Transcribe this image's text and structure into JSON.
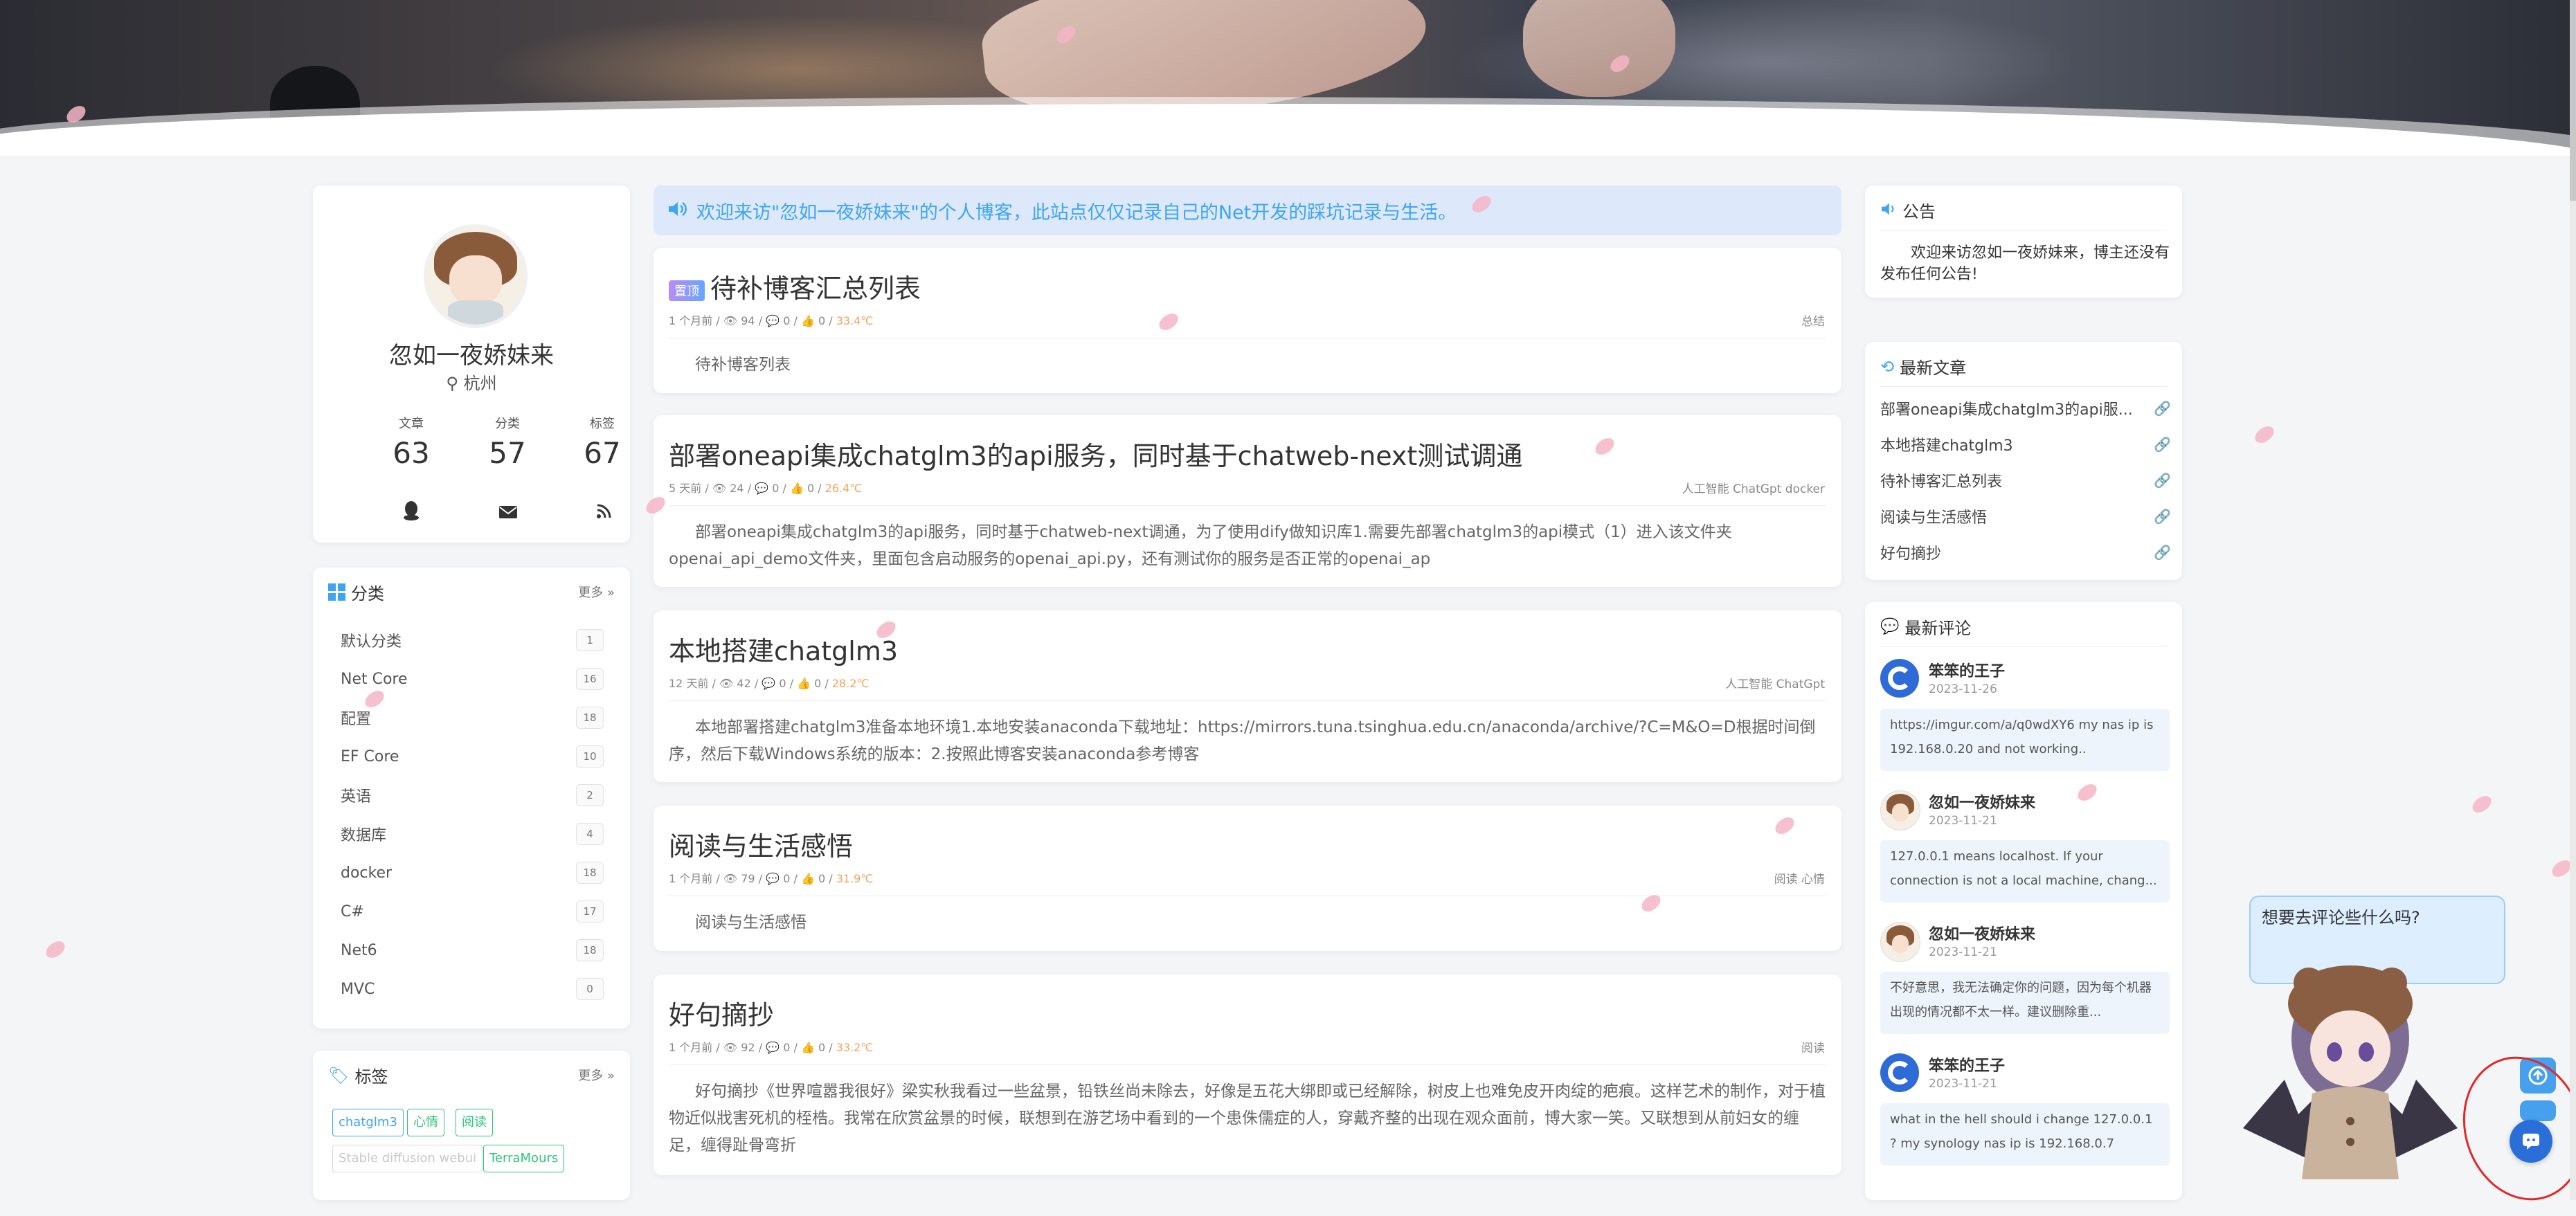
{
  "notice": "欢迎来访\"忽如一夜娇妹来\"的个人博客，此站点仅仅记录自己的Net开发的踩坑记录与生活。",
  "profile": {
    "name": "忽如一夜娇妹来",
    "location": "杭州",
    "stats": [
      {
        "label": "文章",
        "value": "63"
      },
      {
        "label": "分类",
        "value": "57"
      },
      {
        "label": "标签",
        "value": "67"
      }
    ],
    "social_icons": [
      "qq-icon",
      "mail-icon",
      "rss-icon"
    ]
  },
  "categories": {
    "title": "分类",
    "more": "更多",
    "items": [
      {
        "name": "默认分类",
        "count": "1"
      },
      {
        "name": "Net Core",
        "count": "16"
      },
      {
        "name": "配置",
        "count": "18"
      },
      {
        "name": "EF Core",
        "count": "10"
      },
      {
        "name": "英语",
        "count": "2"
      },
      {
        "name": "数据库",
        "count": "4"
      },
      {
        "name": "docker",
        "count": "18"
      },
      {
        "name": "C#",
        "count": "17"
      },
      {
        "name": "Net6",
        "count": "18"
      },
      {
        "name": "MVC",
        "count": "0"
      }
    ]
  },
  "tags": {
    "title": "标签",
    "more": "更多",
    "items": [
      {
        "name": "chatglm3",
        "color": "#3ea5f3"
      },
      {
        "name": "心情",
        "color": "#2ec47a"
      },
      {
        "name": "阅读",
        "color": "#2ec47a"
      },
      {
        "name": "Stable diffusion webui",
        "color": "#c9c9c9"
      },
      {
        "name": "TerraMours",
        "color": "#2ec47a"
      }
    ]
  },
  "posts": [
    {
      "pinned": "置顶",
      "title": "待补博客汇总列表",
      "time": "1 个月前",
      "views": "94",
      "comments": "0",
      "likes": "0",
      "temp": "33.4℃",
      "tags": "总结",
      "excerpt": "待补博客列表"
    },
    {
      "title": "部署oneapi集成chatglm3的api服务，同时基于chatweb-next测试调通",
      "time": "5 天前",
      "views": "24",
      "comments": "0",
      "likes": "0",
      "temp": "26.4℃",
      "tags": "人工智能 ChatGpt docker",
      "excerpt": "部署oneapi集成chatglm3的api服务，同时基于chatweb-next调通，为了使用dify做知识库1.需要先部署chatglm3的api模式（1）进入该文件夹openai_api_demo文件夹，里面包含启动服务的openai_api.py，还有测试你的服务是否正常的openai_ap"
    },
    {
      "title": "本地搭建chatglm3",
      "time": "12 天前",
      "views": "42",
      "comments": "0",
      "likes": "0",
      "temp": "28.2℃",
      "tags": "人工智能 ChatGpt",
      "excerpt": "本地部署搭建chatglm3准备本地环境1.本地安装anaconda下载地址：https://mirrors.tuna.tsinghua.edu.cn/anaconda/archive/?C=M&O=D根据时间倒序，然后下载Windows系统的版本：2.按照此博客安装anaconda参考博客"
    },
    {
      "title": "阅读与生活感悟",
      "time": "1 个月前",
      "views": "79",
      "comments": "0",
      "likes": "0",
      "temp": "31.9℃",
      "tags": "阅读 心情",
      "excerpt": "阅读与生活感悟"
    },
    {
      "title": "好句摘抄",
      "time": "1 个月前",
      "views": "92",
      "comments": "0",
      "likes": "0",
      "temp": "33.2℃",
      "tags": "阅读",
      "excerpt": "好句摘抄《世界喧嚣我很好》梁实秋我看过一些盆景，铅铁丝尚未除去，好像是五花大绑即或已经解除，树皮上也难免皮开肉绽的疤痕。这样艺术的制作，对于植物近似戕害死机的桎梏。我常在欣赏盆景的时候，联想到在游艺场中看到的一个患侏儒症的人，穿戴齐整的出现在观众面前，博大家一笑。又联想到从前妇女的缠足，缠得趾骨弯折"
    }
  ],
  "announcement": {
    "title": "公告",
    "text": "欢迎来访忽如一夜娇妹来，博主还没有发布任何公告!"
  },
  "latest_posts": {
    "title": "最新文章",
    "items": [
      "部署oneapi集成chatglm3的api服...",
      "本地搭建chatglm3",
      "待补博客汇总列表",
      "阅读与生活感悟",
      "好句摘抄"
    ]
  },
  "latest_comments": {
    "title": "最新评论",
    "items": [
      {
        "name": "笨笨的王子",
        "date": "2023-11-26",
        "avatar": "github-avatar",
        "text": "https://imgur.com/a/q0wdXY6 my nas ip is 192.168.0.20 and not working.."
      },
      {
        "name": "忽如一夜娇妹来",
        "date": "2023-11-21",
        "avatar": "girl-avatar",
        "text": "127.0.0.1 means localhost. If your connection is not a local machine, chang..."
      },
      {
        "name": "忽如一夜娇妹来",
        "date": "2023-11-21",
        "avatar": "girl-avatar",
        "text": "不好意思，我无法确定你的问题，因为每个机器出现的情况都不太一样。建议删除重..."
      },
      {
        "name": "笨笨的王子",
        "date": "2023-11-21",
        "avatar": "github-avatar",
        "text": "what in the hell should i change 127.0.0.1 ? my synology nas ip is 192.168.0.7"
      }
    ]
  },
  "mascot_bubble": "想要去评论些什么吗?",
  "colors": {
    "accent": "#3ea5f3",
    "temp": "#f0a55a",
    "notice_bg": "#dde9fb"
  }
}
